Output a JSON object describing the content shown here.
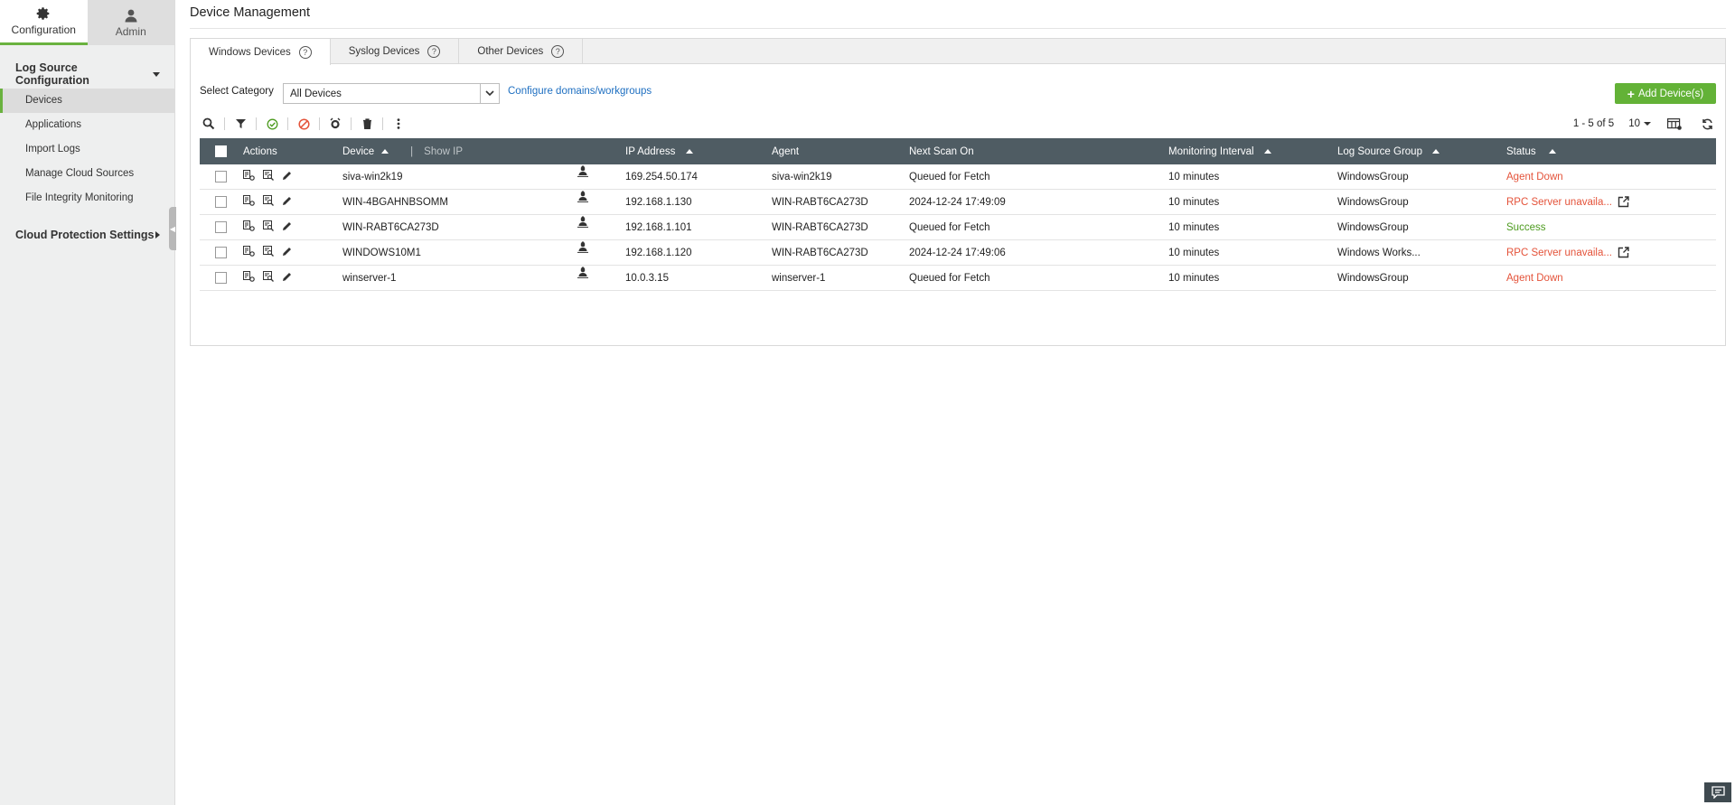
{
  "nav": {
    "tabs": [
      {
        "label": "Configuration",
        "icon": "gear-icon"
      },
      {
        "label": "Admin",
        "icon": "user-icon"
      }
    ],
    "sections": [
      {
        "label": "Log Source Configuration",
        "items": [
          "Devices",
          "Applications",
          "Import Logs",
          "Manage Cloud Sources",
          "File Integrity Monitoring"
        ]
      },
      {
        "label": "Cloud Protection Settings"
      }
    ],
    "active_item": "Devices"
  },
  "page": {
    "title": "Device Management"
  },
  "tabs": [
    {
      "label": "Windows Devices"
    },
    {
      "label": "Syslog Devices"
    },
    {
      "label": "Other Devices"
    }
  ],
  "filter": {
    "category_label": "Select Category",
    "category_value": "All Devices",
    "configure_link": "Configure domains/workgroups",
    "add_button": "Add Device(s)"
  },
  "pagination": {
    "range": "1 - 5 of 5",
    "per_page": "10"
  },
  "table": {
    "headers": {
      "actions": "Actions",
      "device": "Device",
      "show_ip": "Show IP",
      "ip": "IP Address",
      "agent": "Agent",
      "next_scan": "Next Scan On",
      "interval": "Monitoring Interval",
      "group": "Log Source Group",
      "status": "Status"
    },
    "rows": [
      {
        "device": "siva-win2k19",
        "ip": "169.254.50.174",
        "agent": "siva-win2k19",
        "next_scan": "Queued for Fetch",
        "interval": "10 minutes",
        "group": "WindowsGroup",
        "status": "Agent Down"
      },
      {
        "device": "WIN-4BGAHNBSOMM",
        "ip": "192.168.1.130",
        "agent": "WIN-RABT6CA273D",
        "next_scan": "2024-12-24 17:49:09",
        "interval": "10 minutes",
        "group": "WindowsGroup",
        "status": "RPC Server unavaila..."
      },
      {
        "device": "WIN-RABT6CA273D",
        "ip": "192.168.1.101",
        "agent": "WIN-RABT6CA273D",
        "next_scan": "Queued for Fetch",
        "interval": "10 minutes",
        "group": "WindowsGroup",
        "status": "Success"
      },
      {
        "device": "WINDOWS10M1",
        "ip": "192.168.1.120",
        "agent": "WIN-RABT6CA273D",
        "next_scan": "2024-12-24 17:49:06",
        "interval": "10 minutes",
        "group": "Windows Works...",
        "status": "RPC Server unavaila..."
      },
      {
        "device": "winserver-1",
        "ip": "10.0.3.15",
        "agent": "winserver-1",
        "next_scan": "Queued for Fetch",
        "interval": "10 minutes",
        "group": "WindowsGroup",
        "status": "Agent Down"
      }
    ]
  },
  "colors": {
    "accent": "#6ab23f",
    "header_bg": "#4f5c63",
    "error": "#e4533a",
    "success": "#4d9b1f",
    "link": "#1e6fc1"
  }
}
